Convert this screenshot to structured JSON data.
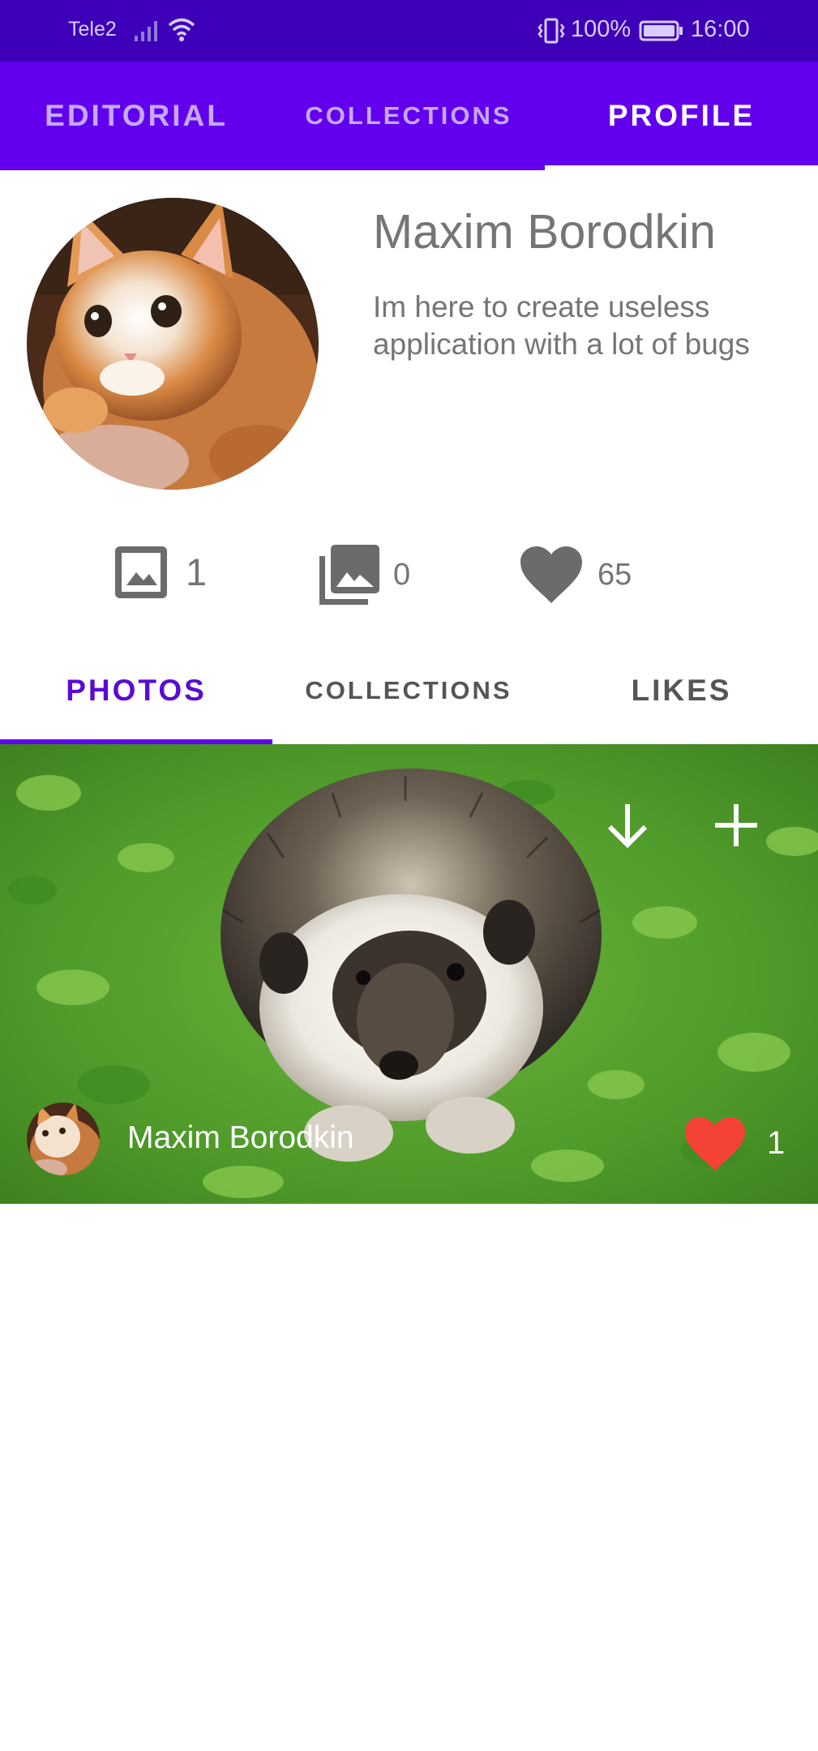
{
  "status_bar": {
    "carrier": "Tele2",
    "battery": "100%",
    "time": "16:00",
    "icons": [
      "signal-icon",
      "wifi-icon",
      "vibrate-icon",
      "battery-icon"
    ]
  },
  "top_tabs": [
    {
      "label": "EDITORIAL",
      "selected": false
    },
    {
      "label": "COLLECTIONS",
      "selected": false
    },
    {
      "label": "PROFILE",
      "selected": true
    }
  ],
  "profile": {
    "name": "Maxim Borodkin",
    "bio": "Im here to create useless application with a lot of bugs"
  },
  "stats": {
    "photos": {
      "icon": "photo-icon",
      "value": "1"
    },
    "collections": {
      "icon": "photo-library-icon",
      "value": "0"
    },
    "likes": {
      "icon": "heart-icon",
      "value": "65"
    }
  },
  "sub_tabs": [
    {
      "label": "PHOTOS",
      "selected": true
    },
    {
      "label": "COLLECTIONS",
      "selected": false
    },
    {
      "label": "LIKES",
      "selected": false
    }
  ],
  "photos": [
    {
      "author": "Maxim Borodkin",
      "likes": "1",
      "actions": [
        "download-icon",
        "add-icon"
      ]
    }
  ],
  "colors": {
    "status_bar": "#3d00b8",
    "primary": "#6200ee",
    "accent_text": "#5a0bd3",
    "like_heart": "#f44336",
    "secondary_text": "#757575"
  }
}
